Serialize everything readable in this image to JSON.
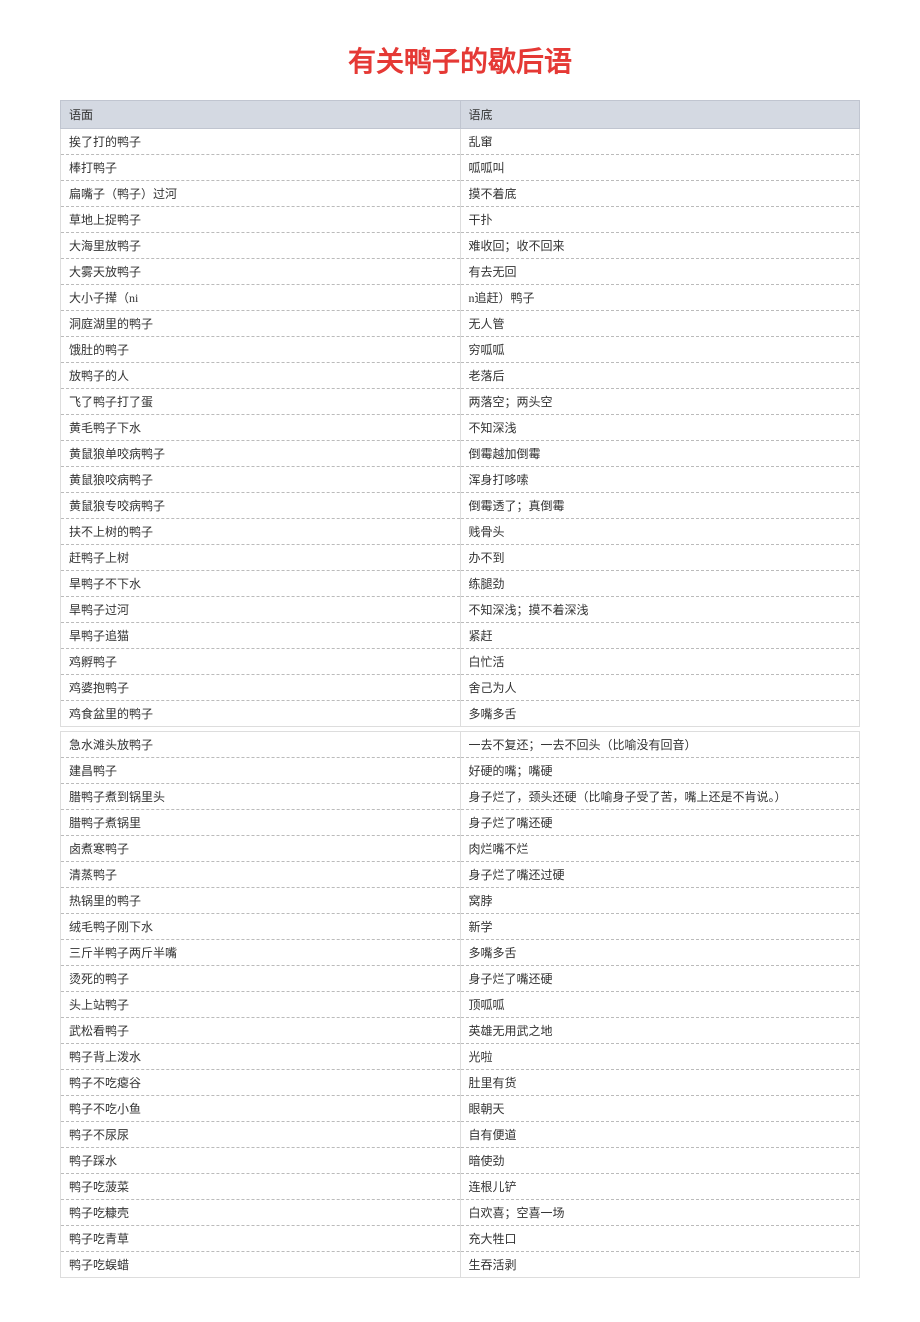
{
  "title": "有关鸭子的歇后语",
  "headers": {
    "col1": "语面",
    "col2": "语底"
  },
  "table1_rows": [
    {
      "c1": "挨了打的鸭子",
      "c2": "乱窜"
    },
    {
      "c1": "棒打鸭子",
      "c2": "呱呱叫"
    },
    {
      "c1": "扁嘴子（鸭子）过河",
      "c2": "摸不着底"
    },
    {
      "c1": "草地上捉鸭子",
      "c2": "干扑"
    },
    {
      "c1": "大海里放鸭子",
      "c2": "难收回；收不回来"
    },
    {
      "c1": "大雾天放鸭子",
      "c2": "有去无回"
    },
    {
      "c1": "大小子撵（ni",
      "c2": "n追赶）鸭子"
    },
    {
      "c1": "洞庭湖里的鸭子",
      "c2": "无人管"
    },
    {
      "c1": "饿肚的鸭子",
      "c2": "穷呱呱"
    },
    {
      "c1": "放鸭子的人",
      "c2": "老落后"
    },
    {
      "c1": "飞了鸭子打了蛋",
      "c2": "两落空；两头空"
    },
    {
      "c1": "黄毛鸭子下水",
      "c2": "不知深浅"
    },
    {
      "c1": "黄鼠狼单咬病鸭子",
      "c2": "倒霉越加倒霉"
    },
    {
      "c1": "黄鼠狼咬病鸭子",
      "c2": "浑身打哆嗦"
    },
    {
      "c1": "黄鼠狼专咬病鸭子",
      "c2": "倒霉透了；真倒霉"
    },
    {
      "c1": "扶不上树的鸭子",
      "c2": "贱骨头"
    },
    {
      "c1": "赶鸭子上树",
      "c2": "办不到"
    },
    {
      "c1": "旱鸭子不下水",
      "c2": "练腿劲"
    },
    {
      "c1": "旱鸭子过河",
      "c2": "不知深浅；摸不着深浅"
    },
    {
      "c1": "旱鸭子追猫",
      "c2": "紧赶"
    },
    {
      "c1": "鸡孵鸭子",
      "c2": "白忙活"
    },
    {
      "c1": "鸡婆抱鸭子",
      "c2": "舍己为人"
    },
    {
      "c1": "鸡食盆里的鸭子",
      "c2": "多嘴多舌"
    }
  ],
  "table2_rows": [
    {
      "c1": "急水滩头放鸭子",
      "c2": "一去不复还；一去不回头（比喻没有回音）"
    },
    {
      "c1": "建昌鸭子",
      "c2": "好硬的嘴；嘴硬"
    },
    {
      "c1": "腊鸭子煮到锅里头",
      "c2": "身子烂了，颈头还硬（比喻身子受了苦，嘴上还是不肯说。）"
    },
    {
      "c1": "腊鸭子煮锅里",
      "c2": "身子烂了嘴还硬"
    },
    {
      "c1": "卤煮寒鸭子",
      "c2": "肉烂嘴不烂"
    },
    {
      "c1": "清蒸鸭子",
      "c2": "身子烂了嘴还过硬"
    },
    {
      "c1": "热锅里的鸭子",
      "c2": "窝脖"
    },
    {
      "c1": "绒毛鸭子刚下水",
      "c2": "新学"
    },
    {
      "c1": "三斤半鸭子两斤半嘴",
      "c2": "多嘴多舌"
    },
    {
      "c1": "烫死的鸭子",
      "c2": "身子烂了嘴还硬"
    },
    {
      "c1": "头上站鸭子",
      "c2": "顶呱呱"
    },
    {
      "c1": "武松看鸭子",
      "c2": "英雄无用武之地"
    },
    {
      "c1": "鸭子背上泼水",
      "c2": "光啦"
    },
    {
      "c1": "鸭子不吃瘪谷",
      "c2": "肚里有货"
    },
    {
      "c1": "鸭子不吃小鱼",
      "c2": "眼朝天"
    },
    {
      "c1": "鸭子不尿尿",
      "c2": "自有便道"
    },
    {
      "c1": "鸭子踩水",
      "c2": "暗使劲"
    },
    {
      "c1": "鸭子吃菠菜",
      "c2": "连根儿铲"
    },
    {
      "c1": "鸭子吃糠壳",
      "c2": "白欢喜；空喜一场"
    },
    {
      "c1": "鸭子吃青草",
      "c2": "充大牲口"
    },
    {
      "c1": "鸭子吃蜈蜡",
      "c2": "生吞活剥"
    }
  ]
}
